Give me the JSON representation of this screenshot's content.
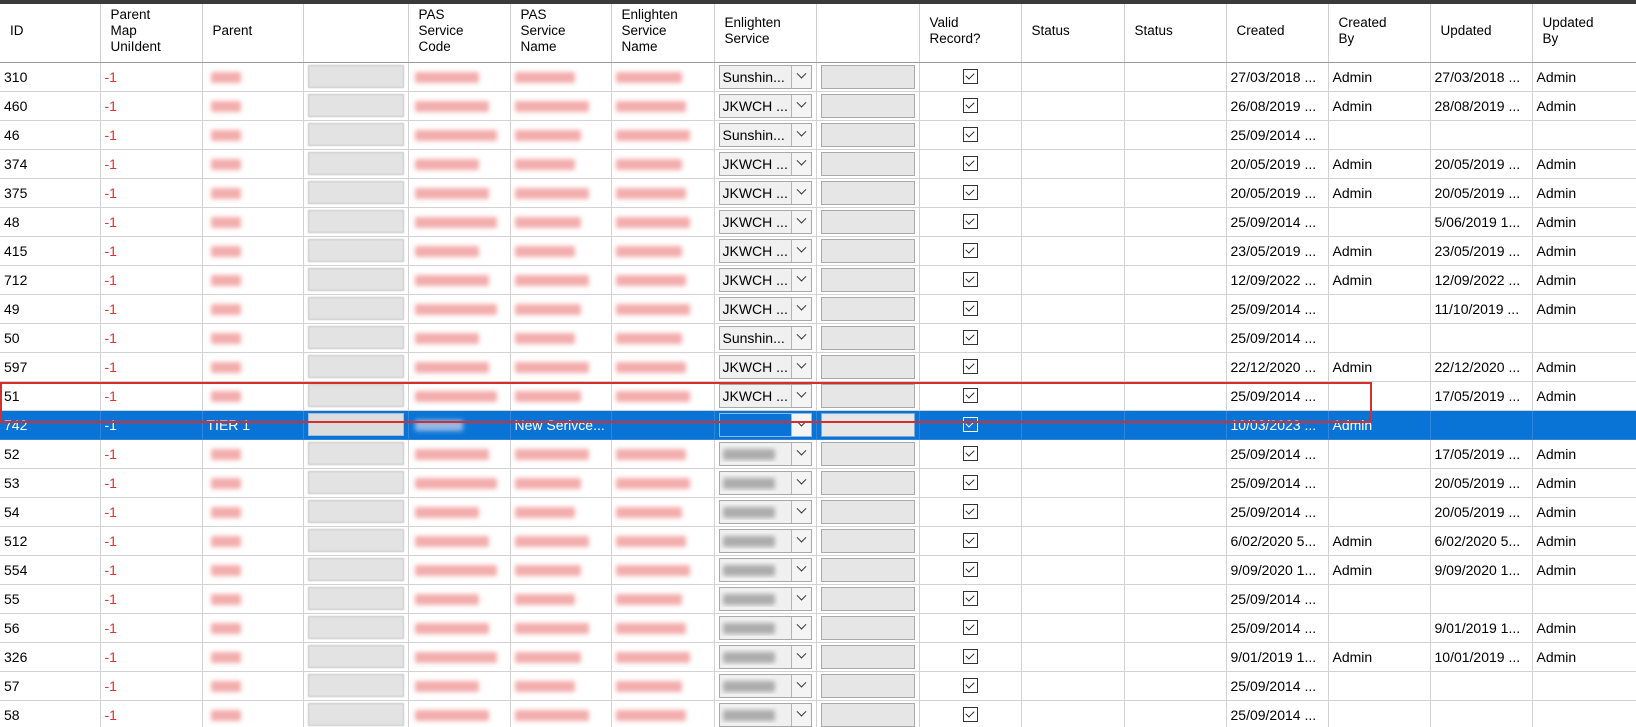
{
  "columns": [
    "ID",
    "Parent\nMap\nUniIdent",
    "Parent",
    "",
    "PAS\nService\nCode",
    "PAS\nService\nName",
    "Enlighten\nService\nName",
    "Enlighten\nService",
    "",
    "Valid\nRecord?",
    "Status",
    "Status",
    "Created",
    "Created\nBy",
    "Updated",
    "Updated\nBy"
  ],
  "rows": [
    {
      "id": "310",
      "parent_map": "-1",
      "enlighten_service": "Sunshin...",
      "valid": true,
      "created": "27/03/2018 ...",
      "created_by": "Admin",
      "updated": "27/03/2018 ...",
      "updated_by": "Admin"
    },
    {
      "id": "460",
      "parent_map": "-1",
      "enlighten_service": "JKWCH ...",
      "valid": true,
      "created": "26/08/2019 ...",
      "created_by": "Admin",
      "updated": "28/08/2019 ...",
      "updated_by": "Admin"
    },
    {
      "id": "46",
      "parent_map": "-1",
      "enlighten_service": "Sunshin...",
      "valid": true,
      "created": "25/09/2014 ...",
      "created_by": "",
      "updated": "",
      "updated_by": ""
    },
    {
      "id": "374",
      "parent_map": "-1",
      "enlighten_service": "JKWCH ...",
      "valid": true,
      "created": "20/05/2019 ...",
      "created_by": "Admin",
      "updated": "20/05/2019 ...",
      "updated_by": "Admin"
    },
    {
      "id": "375",
      "parent_map": "-1",
      "enlighten_service": "JKWCH ...",
      "valid": true,
      "created": "20/05/2019 ...",
      "created_by": "Admin",
      "updated": "20/05/2019 ...",
      "updated_by": "Admin"
    },
    {
      "id": "48",
      "parent_map": "-1",
      "enlighten_service": "JKWCH ...",
      "valid": true,
      "created": "25/09/2014 ...",
      "created_by": "",
      "updated": "5/06/2019 1...",
      "updated_by": "Admin"
    },
    {
      "id": "415",
      "parent_map": "-1",
      "enlighten_service": "JKWCH ...",
      "valid": true,
      "created": "23/05/2019 ...",
      "created_by": "Admin",
      "updated": "23/05/2019 ...",
      "updated_by": "Admin"
    },
    {
      "id": "712",
      "parent_map": "-1",
      "enlighten_service": "JKWCH ...",
      "valid": true,
      "created": "12/09/2022 ...",
      "created_by": "Admin",
      "updated": "12/09/2022 ...",
      "updated_by": "Admin"
    },
    {
      "id": "49",
      "parent_map": "-1",
      "enlighten_service": "JKWCH ...",
      "valid": true,
      "created": "25/09/2014 ...",
      "created_by": "",
      "updated": "11/10/2019 ...",
      "updated_by": "Admin"
    },
    {
      "id": "50",
      "parent_map": "-1",
      "enlighten_service": "Sunshin...",
      "valid": true,
      "created": "25/09/2014 ...",
      "created_by": "",
      "updated": "",
      "updated_by": ""
    },
    {
      "id": "597",
      "parent_map": "-1",
      "enlighten_service": "JKWCH ...",
      "valid": true,
      "created": "22/12/2020 ...",
      "created_by": "Admin",
      "updated": "22/12/2020 ...",
      "updated_by": "Admin"
    },
    {
      "id": "51",
      "parent_map": "-1",
      "enlighten_service": "JKWCH ...",
      "valid": true,
      "created": "25/09/2014 ...",
      "created_by": "",
      "updated": "17/05/2019 ...",
      "updated_by": "Admin"
    },
    {
      "id": "742",
      "parent_map": "-1",
      "parent": "TIER 1",
      "pas_service_code": "",
      "pas_service_name": "New Serivce...",
      "enlighten_service": "",
      "valid": true,
      "created": "10/03/2023 ...",
      "created_by": "Admin",
      "updated": "",
      "updated_by": "",
      "selected": true
    },
    {
      "id": "52",
      "parent_map": "-1",
      "enlighten_service": "",
      "valid": true,
      "created": "25/09/2014 ...",
      "created_by": "",
      "updated": "17/05/2019 ...",
      "updated_by": "Admin"
    },
    {
      "id": "53",
      "parent_map": "-1",
      "enlighten_service": "",
      "valid": true,
      "created": "25/09/2014 ...",
      "created_by": "",
      "updated": "20/05/2019 ...",
      "updated_by": "Admin"
    },
    {
      "id": "54",
      "parent_map": "-1",
      "enlighten_service": "",
      "valid": true,
      "created": "25/09/2014 ...",
      "created_by": "",
      "updated": "20/05/2019 ...",
      "updated_by": "Admin"
    },
    {
      "id": "512",
      "parent_map": "-1",
      "enlighten_service": "",
      "valid": true,
      "created": "6/02/2020 5...",
      "created_by": "Admin",
      "updated": "6/02/2020 5...",
      "updated_by": "Admin"
    },
    {
      "id": "554",
      "parent_map": "-1",
      "enlighten_service": "",
      "valid": true,
      "created": "9/09/2020 1...",
      "created_by": "Admin",
      "updated": "9/09/2020 1...",
      "updated_by": "Admin"
    },
    {
      "id": "55",
      "parent_map": "-1",
      "enlighten_service": "",
      "valid": true,
      "created": "25/09/2014 ...",
      "created_by": "",
      "updated": "",
      "updated_by": ""
    },
    {
      "id": "56",
      "parent_map": "-1",
      "enlighten_service": "",
      "valid": true,
      "created": "25/09/2014 ...",
      "created_by": "",
      "updated": "9/01/2019 1...",
      "updated_by": "Admin"
    },
    {
      "id": "326",
      "parent_map": "-1",
      "enlighten_service": "",
      "valid": true,
      "created": "9/01/2019 1...",
      "created_by": "Admin",
      "updated": "10/01/2019 ...",
      "updated_by": "Admin"
    },
    {
      "id": "57",
      "parent_map": "-1",
      "enlighten_service": "",
      "valid": true,
      "created": "25/09/2014 ...",
      "created_by": "",
      "updated": "",
      "updated_by": ""
    },
    {
      "id": "58",
      "parent_map": "-1",
      "enlighten_service": "",
      "valid": true,
      "created": "25/09/2014 ...",
      "created_by": "",
      "updated": "",
      "updated_by": ""
    }
  ],
  "colors": {
    "selection": "#0a74d6",
    "negative_text": "#e0312f",
    "highlight_border": "#d62d2d"
  }
}
